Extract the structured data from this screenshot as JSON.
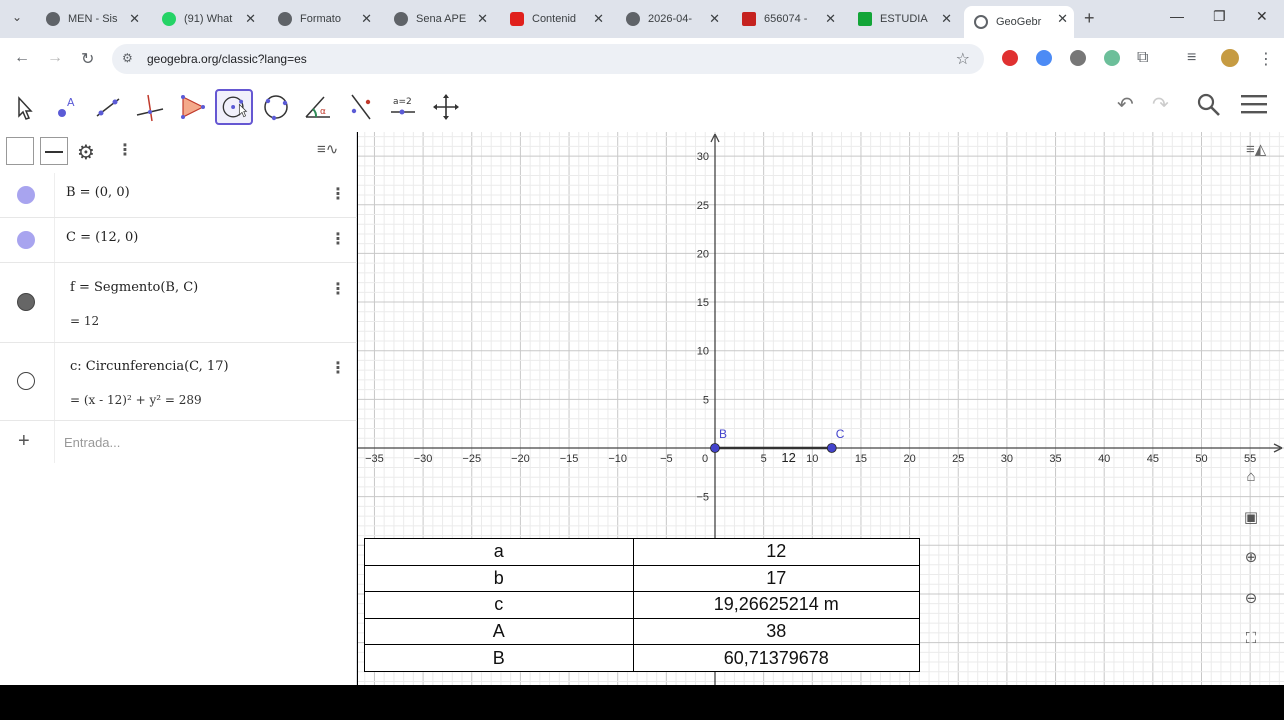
{
  "browser": {
    "tabs": [
      {
        "title": "MEN - Sis",
        "favicon_color": "#5f6368"
      },
      {
        "title": "(91) What",
        "favicon_color": "#25d366"
      },
      {
        "title": "Formato",
        "favicon_color": "#5f6368"
      },
      {
        "title": "Sena APE",
        "favicon_color": "#5f6368"
      },
      {
        "title": "Contenid",
        "favicon_color": "#e0201c"
      },
      {
        "title": "2026-04-",
        "favicon_color": "#5f6368"
      },
      {
        "title": "656074 -",
        "favicon_color": "#c5221f"
      },
      {
        "title": "ESTUDIA",
        "favicon_color": "#13a538"
      },
      {
        "title": "GeoGebr",
        "favicon_color": "#5f6368"
      }
    ],
    "new_tab_label": "+",
    "url": "geogebra.org/classic?lang=es"
  },
  "algebra": {
    "input_placeholder": "Entrada...",
    "items": [
      {
        "text": "B = (0, 0)",
        "marker_color": "#a8a4ef"
      },
      {
        "text": "C = (12, 0)",
        "marker_color": "#a8a4ef"
      },
      {
        "text": "f = Segmento(B, C)",
        "value": "= 12",
        "marker_color": "#666666"
      },
      {
        "text": "c: Circunferencia(C, 17)",
        "value": "= (x - 12)² + y² = 289",
        "marker_color": "#ffffff"
      }
    ]
  },
  "graphics": {
    "x_ticks": [
      "−35",
      "−30",
      "−25",
      "−20",
      "−15",
      "−10",
      "−5",
      "0",
      "5",
      "10",
      "15",
      "20",
      "25",
      "30",
      "35",
      "40",
      "45",
      "50",
      "55"
    ],
    "y_ticks": [
      "30",
      "25",
      "20",
      "15",
      "10",
      "5",
      "−5"
    ],
    "point_labels": {
      "B": "B",
      "C": "C"
    },
    "segment_label": "12",
    "colors": {
      "point": "#4444cc",
      "segment": "#333333",
      "grid_major": "#c8c8c8",
      "grid_minor": "#ebebeb"
    }
  },
  "table": {
    "rows": [
      {
        "label": "a",
        "value": "12"
      },
      {
        "label": "b",
        "value": "17"
      },
      {
        "label": "c",
        "value": "19,26625214 m"
      },
      {
        "label": "A",
        "value": "38"
      },
      {
        "label": "B",
        "value": "60,71379678"
      }
    ]
  }
}
